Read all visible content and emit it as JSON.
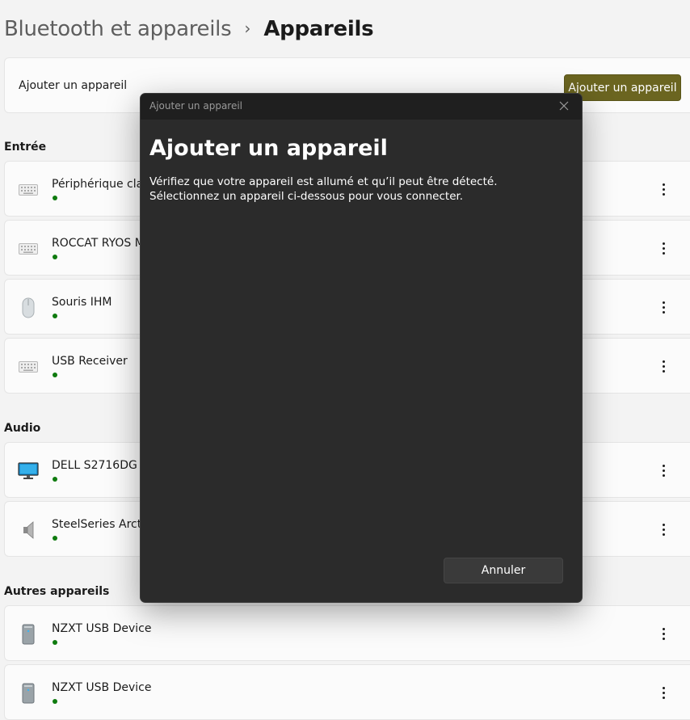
{
  "breadcrumb": {
    "parent": "Bluetooth et appareils",
    "separator": "›",
    "current": "Appareils"
  },
  "add_device": {
    "label": "Ajouter un appareil",
    "button": "Ajouter un appareil"
  },
  "sections": {
    "input": {
      "title": "Entrée",
      "devices": [
        {
          "name": "Périphérique clavier",
          "icon": "keyboard-icon",
          "status": "connected"
        },
        {
          "name": "ROCCAT RYOS MK",
          "icon": "keyboard-icon",
          "status": "connected"
        },
        {
          "name": "Souris IHM",
          "icon": "mouse-icon",
          "status": "connected"
        },
        {
          "name": "USB Receiver",
          "icon": "keyboard-icon",
          "status": "connected"
        }
      ]
    },
    "audio": {
      "title": "Audio",
      "devices": [
        {
          "name": "DELL S2716DG",
          "icon": "monitor-icon",
          "status": "connected"
        },
        {
          "name": "SteelSeries Arctis",
          "icon": "speaker-icon",
          "status": "connected"
        }
      ]
    },
    "other": {
      "title": "Autres appareils",
      "devices": [
        {
          "name": "NZXT USB Device",
          "icon": "pc-tower-icon",
          "status": "connected"
        },
        {
          "name": "NZXT USB Device",
          "icon": "pc-tower-icon",
          "status": "connected"
        }
      ]
    }
  },
  "dialog": {
    "window_title": "Ajouter un appareil",
    "heading": "Ajouter un appareil",
    "description": "Vérifiez que votre appareil est allumé et qu’il peut être détecté. Sélectionnez un appareil ci-dessous pour vous connecter.",
    "cancel": "Annuler",
    "close_icon": "close-icon"
  },
  "colors": {
    "accent": "#6b6520",
    "status_ok": "#0f7b0f",
    "dialog_bg": "#2b2b2b"
  }
}
